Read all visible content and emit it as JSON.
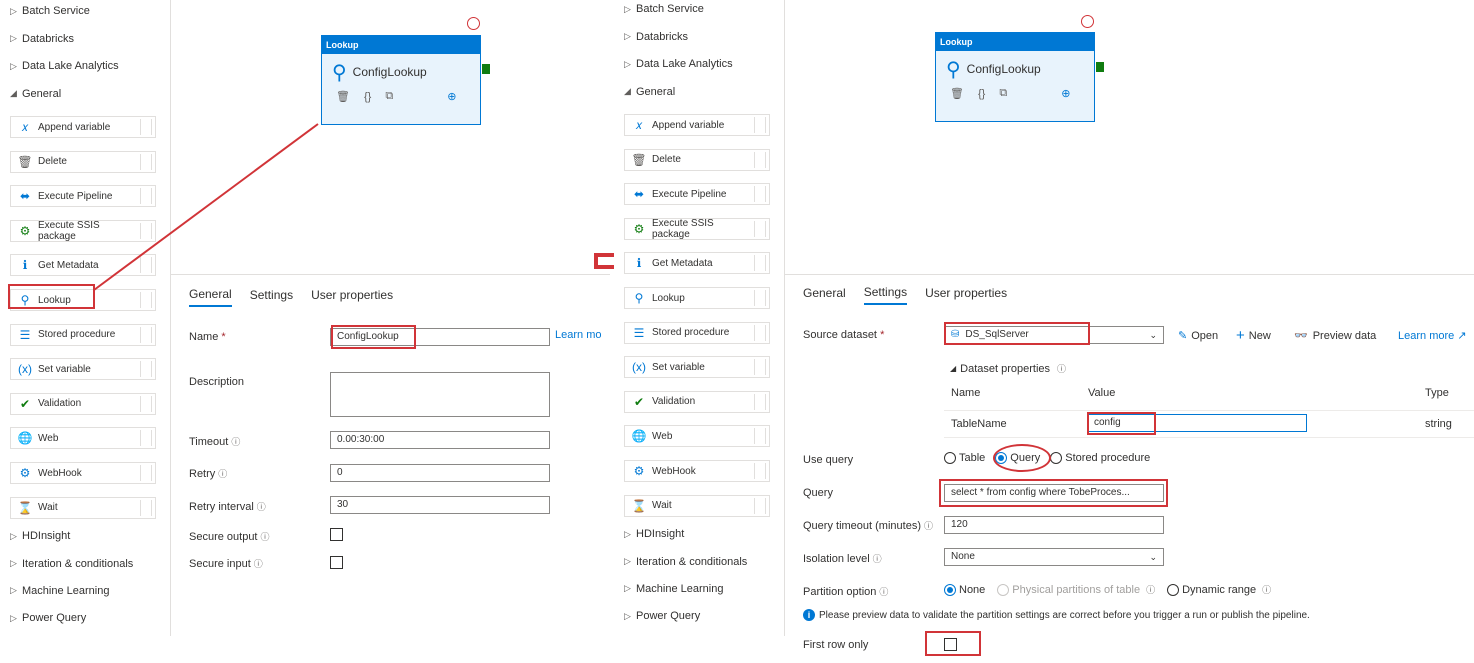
{
  "sidebar": {
    "categories_top": [
      "Batch Service",
      "Databricks",
      "Data Lake Analytics",
      "General"
    ],
    "tools": [
      {
        "label": "Append variable",
        "icon": "variable-icon"
      },
      {
        "label": "Delete",
        "icon": "trash-icon"
      },
      {
        "label": "Execute Pipeline",
        "icon": "pipeline-icon"
      },
      {
        "label": "Execute SSIS package",
        "icon": "ssis-icon"
      },
      {
        "label": "Get Metadata",
        "icon": "info-icon"
      },
      {
        "label": "Lookup",
        "icon": "lookup-icon"
      },
      {
        "label": "Stored procedure",
        "icon": "stored-procedure-icon"
      },
      {
        "label": "Set variable",
        "icon": "set-variable-icon"
      },
      {
        "label": "Validation",
        "icon": "validation-icon"
      },
      {
        "label": "Web",
        "icon": "globe-icon"
      },
      {
        "label": "WebHook",
        "icon": "webhook-icon"
      },
      {
        "label": "Wait",
        "icon": "hourglass-icon"
      }
    ],
    "categories_bottom": [
      "HDInsight",
      "Iteration & conditionals",
      "Machine Learning",
      "Power Query"
    ]
  },
  "activity": {
    "header": "Lookup",
    "title": "ConfigLookup"
  },
  "left": {
    "tabs": [
      "General",
      "Settings",
      "User properties"
    ],
    "active_tab": "General",
    "fields": {
      "name_label": "Name",
      "name_required": "*",
      "name_value": "ConfigLookup",
      "learn_more": "Learn mo",
      "description_label": "Description",
      "timeout_label": "Timeout",
      "timeout_value": "0.00:30:00",
      "retry_label": "Retry",
      "retry_value": "0",
      "retry_interval_label": "Retry interval",
      "retry_interval_value": "30",
      "secure_output_label": "Secure output",
      "secure_input_label": "Secure input"
    }
  },
  "right": {
    "tabs": [
      "General",
      "Settings",
      "User properties"
    ],
    "active_tab": "Settings",
    "source_dataset_label": "Source dataset",
    "source_required": "*",
    "source_dataset_value": "DS_SqlServer",
    "open_label": "Open",
    "new_label": "New",
    "preview_label": "Preview data",
    "learn_more": "Learn more",
    "dataset_properties_label": "Dataset properties",
    "table_headers": [
      "Name",
      "Value",
      "Type"
    ],
    "table_row": {
      "name": "TableName",
      "value": "config",
      "type": "string"
    },
    "use_query_label": "Use query",
    "use_query_options": [
      "Table",
      "Query",
      "Stored procedure"
    ],
    "use_query_selected": "Query",
    "query_label": "Query",
    "query_value": "select * from config where TobeProces...",
    "query_timeout_label": "Query timeout (minutes)",
    "query_timeout_value": "120",
    "isolation_label": "Isolation level",
    "isolation_value": "None",
    "partition_label": "Partition option",
    "partition_options": [
      "None",
      "Physical partitions of table",
      "Dynamic range"
    ],
    "partition_selected": "None",
    "partition_note": "Please preview data to validate the partition settings are correct before you trigger a run or publish the pipeline.",
    "first_row_label": "First row only"
  },
  "colors": {
    "accent": "#0078d4",
    "highlight": "#d13438",
    "port": "#107c10"
  }
}
